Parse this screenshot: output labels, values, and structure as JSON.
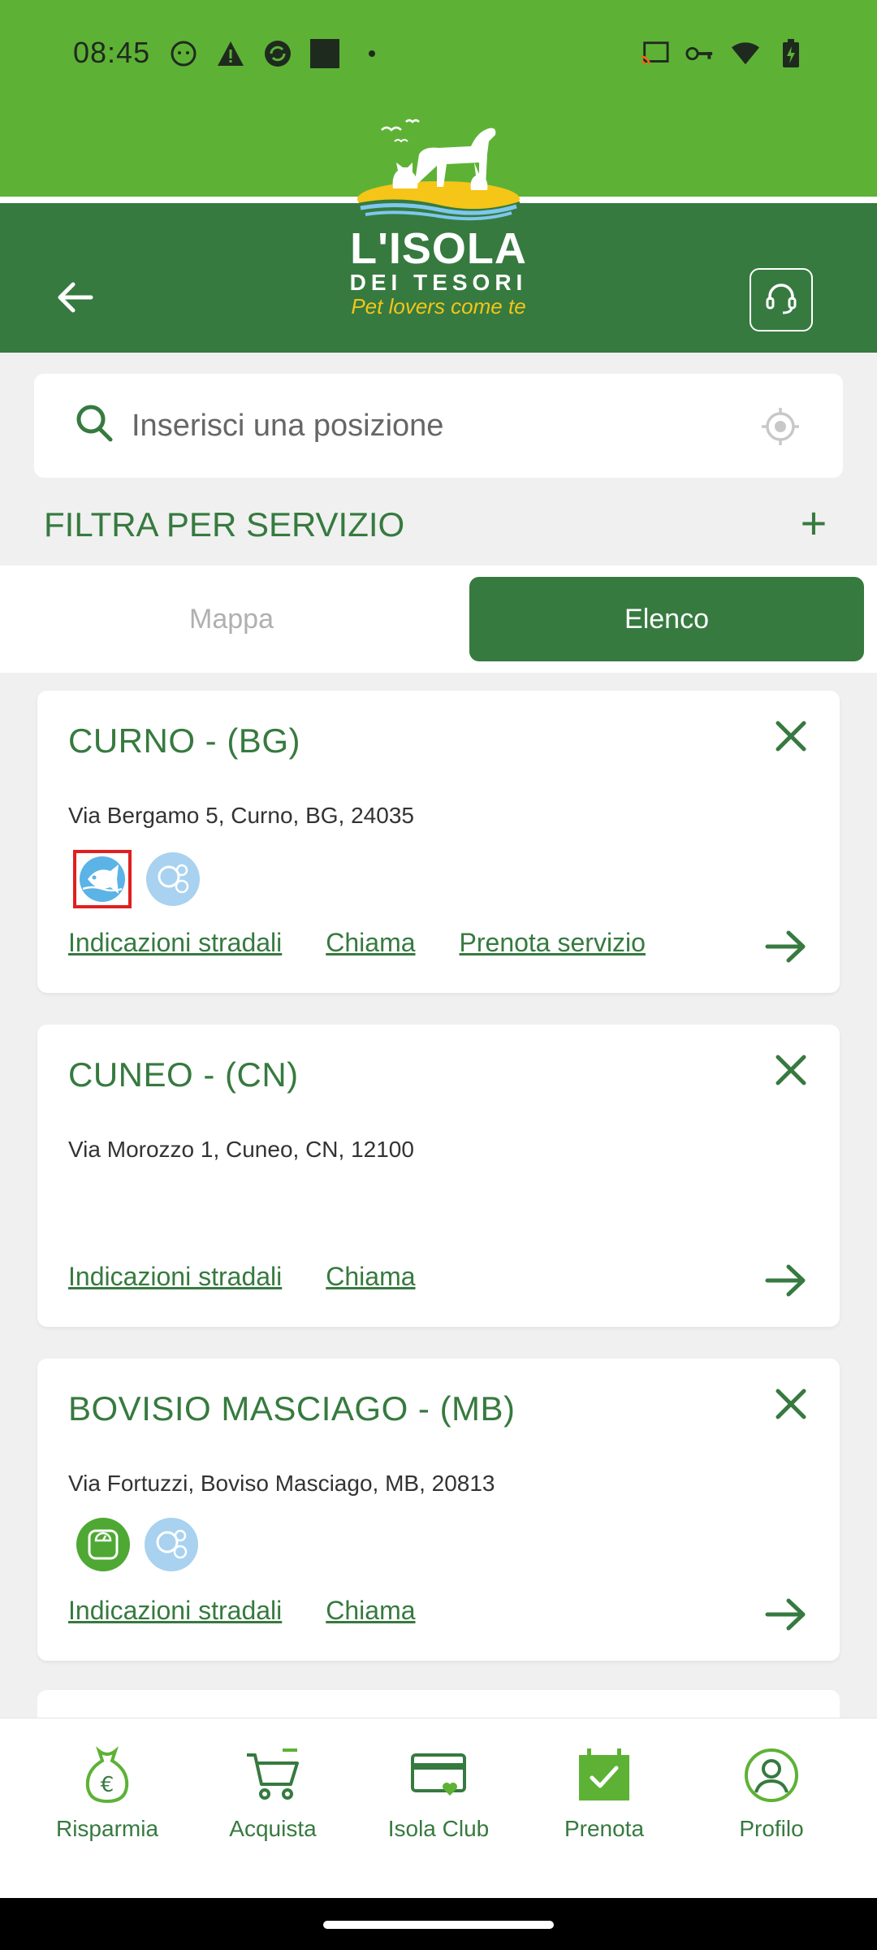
{
  "status_bar": {
    "time": "08:45"
  },
  "header": {
    "logo": {
      "title": "L'ISOLA",
      "subtitle": "DEI TESORI",
      "tagline": "Pet lovers come te"
    }
  },
  "search": {
    "placeholder": "Inserisci una posizione"
  },
  "filter": {
    "label": "FILTRA PER SERVIZIO",
    "plus": "+"
  },
  "tabs": {
    "map": "Mappa",
    "list": "Elenco",
    "active": "list"
  },
  "stores": [
    {
      "name": "CURNO - (BG)",
      "address": "Via Bergamo 5, Curno, BG, 24035",
      "services": [
        "fish-icon",
        "bubbles-icon"
      ],
      "links": [
        "Indicazioni stradali",
        "Chiama",
        "Prenota servizio"
      ]
    },
    {
      "name": "CUNEO - (CN)",
      "address": "Via Morozzo 1, Cuneo, CN, 12100",
      "services": [],
      "links": [
        "Indicazioni stradali",
        "Chiama"
      ]
    },
    {
      "name": "BOVISIO MASCIAGO - (MB)",
      "address": "Via Fortuzzi, Boviso Masciago, MB, 20813",
      "services": [
        "scale-icon",
        "bubbles-icon"
      ],
      "links": [
        "Indicazioni stradali",
        "Chiama"
      ]
    }
  ],
  "bottom_nav": {
    "items": [
      {
        "label": "Risparmia",
        "icon": "money-bag-icon"
      },
      {
        "label": "Acquista",
        "icon": "cart-icon"
      },
      {
        "label": "Isola Club",
        "icon": "card-heart-icon"
      },
      {
        "label": "Prenota",
        "icon": "calendar-check-icon"
      },
      {
        "label": "Profilo",
        "icon": "user-icon"
      }
    ]
  },
  "colors": {
    "brand_dark": "#367a3f",
    "brand_light": "#5db235",
    "accent_yellow": "#f5c518"
  }
}
